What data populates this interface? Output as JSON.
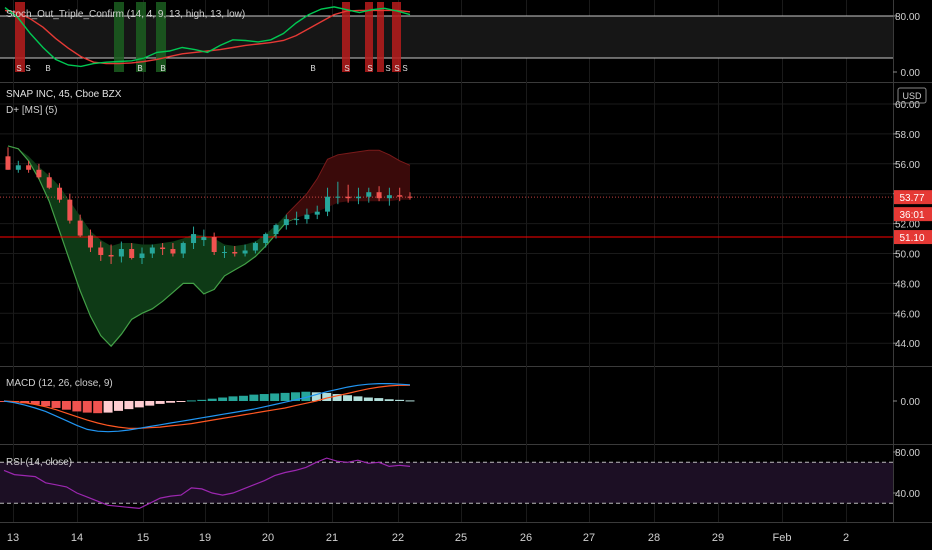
{
  "colors": {
    "background": "#000000",
    "grid": "#1a1a1a",
    "axis_text": "#d0d0d0",
    "up": "#26a69a",
    "down": "#ef5350",
    "red_line": "#ff0000",
    "stoch_k": "#00c853",
    "stoch_d": "#e53935",
    "macd_line": "#2196f3",
    "signal_line": "#ff5722",
    "rsi_line": "#9c27b0",
    "rsi_band": "#1c0f24",
    "dplus_green": "#0e3a16",
    "dplus_red": "#3a0a0a"
  },
  "dates": {
    "labels": [
      "13",
      "14",
      "15",
      "19",
      "20",
      "21",
      "22",
      "25",
      "26",
      "27",
      "28",
      "29",
      "Feb",
      "2"
    ]
  },
  "chart_data": [
    {
      "type": "line",
      "title": "Stoch_Out_Triple_Confirm (14, 4, 9, 13, high, 13, low)",
      "y_ticks": [
        "80.00",
        "0.00"
      ],
      "ylim": [
        0,
        100
      ],
      "series": [
        {
          "values": [
            92,
            78,
            55,
            35,
            18,
            10,
            8,
            12,
            14,
            15,
            16,
            20,
            28,
            30,
            35,
            32,
            28,
            38,
            46,
            45,
            43,
            46,
            55,
            70,
            82,
            90,
            93,
            89,
            85,
            89,
            91,
            87,
            82
          ]
        },
        {
          "values": [
            88,
            85,
            76,
            64,
            48,
            34,
            22,
            14,
            12,
            12,
            13,
            15,
            18,
            22,
            26,
            28,
            30,
            32,
            35,
            38,
            40,
            42,
            45,
            52,
            62,
            72,
            82,
            87,
            88,
            88,
            88,
            88,
            86
          ]
        }
      ],
      "signals": [
        "S",
        "S",
        "B",
        "B",
        "B",
        "B",
        "S",
        "S",
        "S",
        "S",
        "S"
      ]
    },
    {
      "type": "candlestick",
      "title": "SNAP INC, 45, Cboe BZX",
      "indicator": "D+ [MS] (5)",
      "currency": "USD",
      "y_ticks": [
        "60.00",
        "58.00",
        "56.00",
        "54.00",
        "52.00",
        "50.00",
        "48.00",
        "46.00",
        "44.00"
      ],
      "ylim": [
        43,
        60.5
      ],
      "price_labels": [
        "53.77",
        "36:01",
        "51.10"
      ],
      "last_price": 53.77,
      "level_line": 51.1,
      "candles": {
        "open": [
          56.5,
          55.6,
          55.9,
          55.6,
          55.1,
          54.4,
          53.6,
          52.2,
          51.2,
          50.4,
          49.9,
          49.8,
          50.3,
          49.7,
          50.0,
          50.4,
          50.3,
          50.0,
          50.7,
          50.9,
          51.1,
          50.1,
          50.1,
          50.0,
          50.2,
          50.7,
          51.3,
          51.9,
          52.3,
          52.3,
          52.6,
          52.8,
          53.8,
          53.8,
          53.7,
          53.8,
          54.1,
          53.7,
          53.9,
          53.8
        ],
        "high": [
          57.1,
          56.2,
          56.2,
          56.0,
          55.4,
          54.7,
          54.0,
          52.6,
          51.6,
          50.8,
          50.6,
          50.8,
          50.7,
          50.4,
          50.6,
          50.7,
          50.7,
          50.8,
          51.8,
          51.6,
          51.4,
          50.5,
          50.5,
          50.6,
          50.8,
          51.4,
          52.0,
          52.6,
          52.8,
          53.0,
          53.2,
          54.4,
          54.8,
          54.6,
          54.4,
          54.4,
          54.5,
          54.4,
          54.4,
          54.1
        ],
        "low": [
          55.6,
          55.4,
          55.4,
          55.0,
          54.3,
          53.4,
          52.0,
          51.1,
          50.1,
          49.5,
          49.3,
          49.4,
          49.6,
          49.3,
          49.7,
          49.9,
          49.8,
          49.7,
          50.3,
          50.5,
          49.9,
          49.7,
          49.8,
          49.8,
          50.0,
          50.4,
          51.0,
          51.6,
          51.9,
          52.0,
          52.3,
          52.5,
          53.3,
          53.4,
          53.3,
          53.4,
          53.5,
          53.2,
          53.5,
          53.6
        ],
        "close": [
          55.6,
          55.9,
          55.6,
          55.1,
          54.4,
          53.6,
          52.2,
          51.2,
          50.4,
          49.9,
          49.8,
          50.3,
          49.7,
          50.0,
          50.4,
          50.3,
          50.0,
          50.7,
          51.3,
          51.1,
          50.1,
          50.1,
          50.0,
          50.2,
          50.7,
          51.3,
          51.9,
          52.3,
          52.3,
          52.6,
          52.8,
          53.8,
          53.8,
          53.7,
          53.8,
          54.1,
          53.7,
          53.9,
          53.8,
          53.77
        ]
      },
      "band": {
        "upper": [
          57.2,
          57.0,
          56.5,
          55.8,
          55.2,
          54.5,
          53.5,
          52.5,
          51.5,
          50.9,
          50.5,
          50.7,
          50.7,
          50.6,
          50.6,
          50.7,
          50.8,
          51.0,
          51.3,
          51.2,
          51.0,
          50.6,
          50.5,
          50.6,
          50.8,
          51.3,
          51.9,
          52.6,
          53.3,
          54.0,
          55.0,
          56.3,
          56.6,
          56.7,
          56.8,
          56.9,
          56.9,
          56.6,
          56.2,
          55.9
        ],
        "lower": [
          57.2,
          57.0,
          56.2,
          55.0,
          53.5,
          51.5,
          49.5,
          47.5,
          45.8,
          44.5,
          43.8,
          44.6,
          45.6,
          46.0,
          46.3,
          46.8,
          47.4,
          48.0,
          48.0,
          47.3,
          47.6,
          48.5,
          48.9,
          49.3,
          49.8,
          50.5,
          51.3,
          52.1,
          52.4,
          52.6,
          52.8,
          53.1,
          53.4,
          53.5,
          53.5,
          53.5,
          53.5,
          53.5,
          53.6,
          53.6
        ]
      }
    },
    {
      "type": "bar",
      "title": "MACD (12, 26, close, 9)",
      "y_ticks": [
        "0.00"
      ],
      "ylim": [
        -0.6,
        0.38
      ],
      "histogram": [
        -0.005,
        -0.02,
        -0.04,
        -0.06,
        -0.09,
        -0.12,
        -0.15,
        -0.18,
        -0.2,
        -0.21,
        -0.2,
        -0.17,
        -0.14,
        -0.11,
        -0.08,
        -0.05,
        -0.03,
        -0.01,
        0.01,
        0.02,
        0.04,
        0.06,
        0.08,
        0.09,
        0.11,
        0.12,
        0.13,
        0.14,
        0.15,
        0.16,
        0.15,
        0.14,
        0.12,
        0.1,
        0.08,
        0.06,
        0.05,
        0.03,
        0.02,
        0.01
      ],
      "series": [
        {
          "values": [
            0.0,
            -0.03,
            -0.07,
            -0.12,
            -0.18,
            -0.26,
            -0.34,
            -0.42,
            -0.49,
            -0.52,
            -0.53,
            -0.52,
            -0.5,
            -0.47,
            -0.44,
            -0.41,
            -0.38,
            -0.35,
            -0.32,
            -0.29,
            -0.26,
            -0.23,
            -0.2,
            -0.17,
            -0.14,
            -0.1,
            -0.06,
            -0.02,
            0.02,
            0.06,
            0.11,
            0.16,
            0.2,
            0.24,
            0.27,
            0.29,
            0.3,
            0.3,
            0.29,
            0.28
          ]
        },
        {
          "values": [
            0.0,
            -0.01,
            -0.03,
            -0.06,
            -0.1,
            -0.15,
            -0.21,
            -0.27,
            -0.33,
            -0.38,
            -0.42,
            -0.45,
            -0.47,
            -0.47,
            -0.46,
            -0.45,
            -0.43,
            -0.41,
            -0.39,
            -0.36,
            -0.33,
            -0.3,
            -0.27,
            -0.24,
            -0.21,
            -0.18,
            -0.15,
            -0.12,
            -0.08,
            -0.04,
            0.0,
            0.05,
            0.09,
            0.13,
            0.17,
            0.21,
            0.24,
            0.26,
            0.27,
            0.27
          ]
        }
      ]
    },
    {
      "type": "line",
      "title": "RSI (14, close)",
      "y_ticks": [
        "80.00",
        "40.00"
      ],
      "ylim": [
        20,
        88
      ],
      "band": [
        30,
        70
      ],
      "series": [
        {
          "values": [
            62,
            58,
            57,
            56,
            50,
            48,
            46,
            40,
            36,
            32,
            28,
            27,
            26,
            25,
            30,
            35,
            37,
            38,
            45,
            44,
            40,
            38,
            40,
            44,
            48,
            52,
            57,
            60,
            62,
            65,
            70,
            74,
            71,
            70,
            72,
            69,
            70,
            66,
            67,
            66
          ]
        }
      ]
    }
  ]
}
